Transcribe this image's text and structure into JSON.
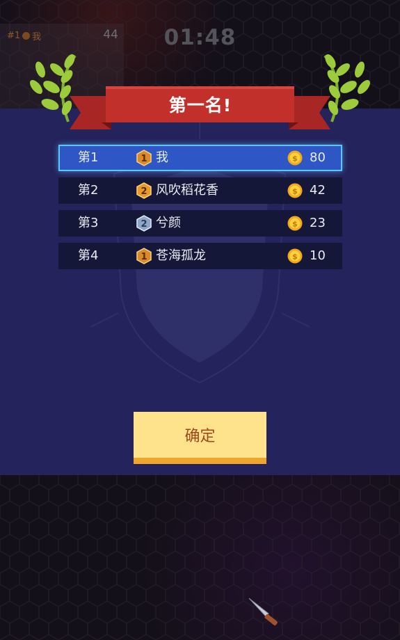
{
  "hud": {
    "rank_label": "#1",
    "player_name": "我",
    "score": "44"
  },
  "timer": "01:48",
  "title": "第一名!",
  "rankings": [
    {
      "place": "第1",
      "name": "我",
      "badge": "1",
      "coins": "80"
    },
    {
      "place": "第2",
      "name": "风吹稻花香",
      "badge": "2",
      "coins": "42"
    },
    {
      "place": "第3",
      "name": "兮颜",
      "badge": "2",
      "coins": "23"
    },
    {
      "place": "第4",
      "name": "苍海孤龙",
      "badge": "1",
      "coins": "10"
    }
  ],
  "confirm_label": "确定",
  "colors": {
    "panel": "#24235c",
    "ribbon": "#c2302c",
    "highlight_row": "#2e56c4",
    "row": "#141737",
    "button": "#ffe38c",
    "button_text": "#a0461c",
    "laurel": "#9ccc3c"
  }
}
